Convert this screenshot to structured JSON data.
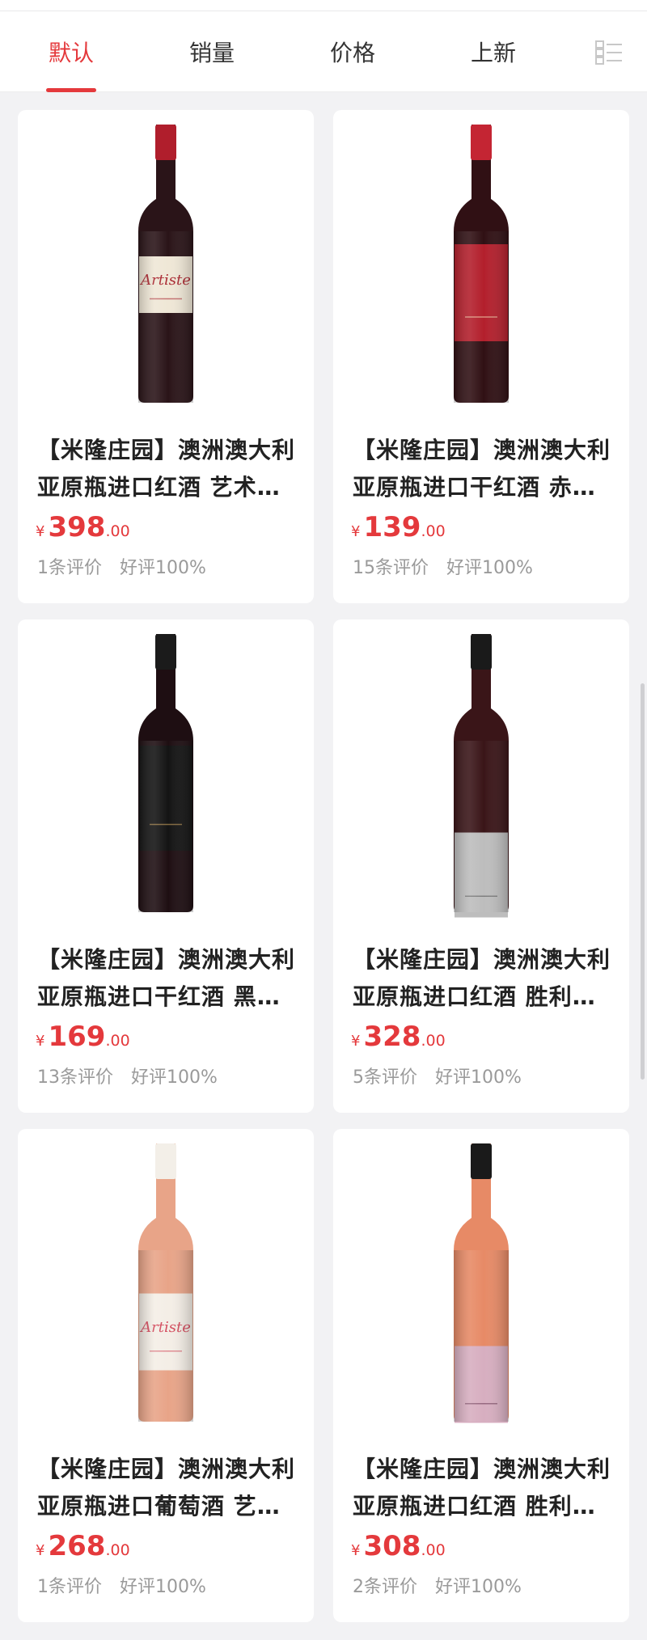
{
  "tabs": [
    {
      "label": "默认",
      "active": true
    },
    {
      "label": "销量",
      "active": false
    },
    {
      "label": "价格",
      "active": false
    },
    {
      "label": "上新",
      "active": false
    }
  ],
  "layout_toggle_icon": "list-view-icon",
  "accent_color": "#e4393c",
  "currency": "¥",
  "products": [
    {
      "title": "【米隆庄园】澳洲澳大利亚原瓶进口红酒 艺术家西拉干红葡萄酒",
      "price_int": "398",
      "price_dec": ".00",
      "reviews": "1条评价",
      "rating": "好评100%",
      "bottle": "artiste-red"
    },
    {
      "title": "【米隆庄园】澳洲澳大利亚原瓶进口干红酒 赤霞珠干红葡萄酒",
      "price_int": "139",
      "price_dec": ".00",
      "reviews": "15条评价",
      "rating": "好评100%",
      "bottle": "red-label"
    },
    {
      "title": "【米隆庄园】澳洲澳大利亚原瓶进口干红酒 黑标干红葡萄酒",
      "price_int": "169",
      "price_dec": ".00",
      "reviews": "13条评价",
      "rating": "好评100%",
      "bottle": "black-label"
    },
    {
      "title": "【米隆庄园】澳洲澳大利亚原瓶进口红酒 胜利干红葡萄酒",
      "price_int": "328",
      "price_dec": ".00",
      "reviews": "5条评价",
      "rating": "好评100%",
      "bottle": "silver-label"
    },
    {
      "title": "【米隆庄园】澳洲澳大利亚原瓶进口葡萄酒 艺术家桃红葡萄酒",
      "price_int": "268",
      "price_dec": ".00",
      "reviews": "1条评价",
      "rating": "好评100%",
      "bottle": "artiste-rose"
    },
    {
      "title": "【米隆庄园】澳洲澳大利亚原瓶进口红酒 胜利桃红葡萄酒",
      "price_int": "308",
      "price_dec": ".00",
      "reviews": "2条评价",
      "rating": "好评100%",
      "bottle": "rose-label"
    }
  ]
}
